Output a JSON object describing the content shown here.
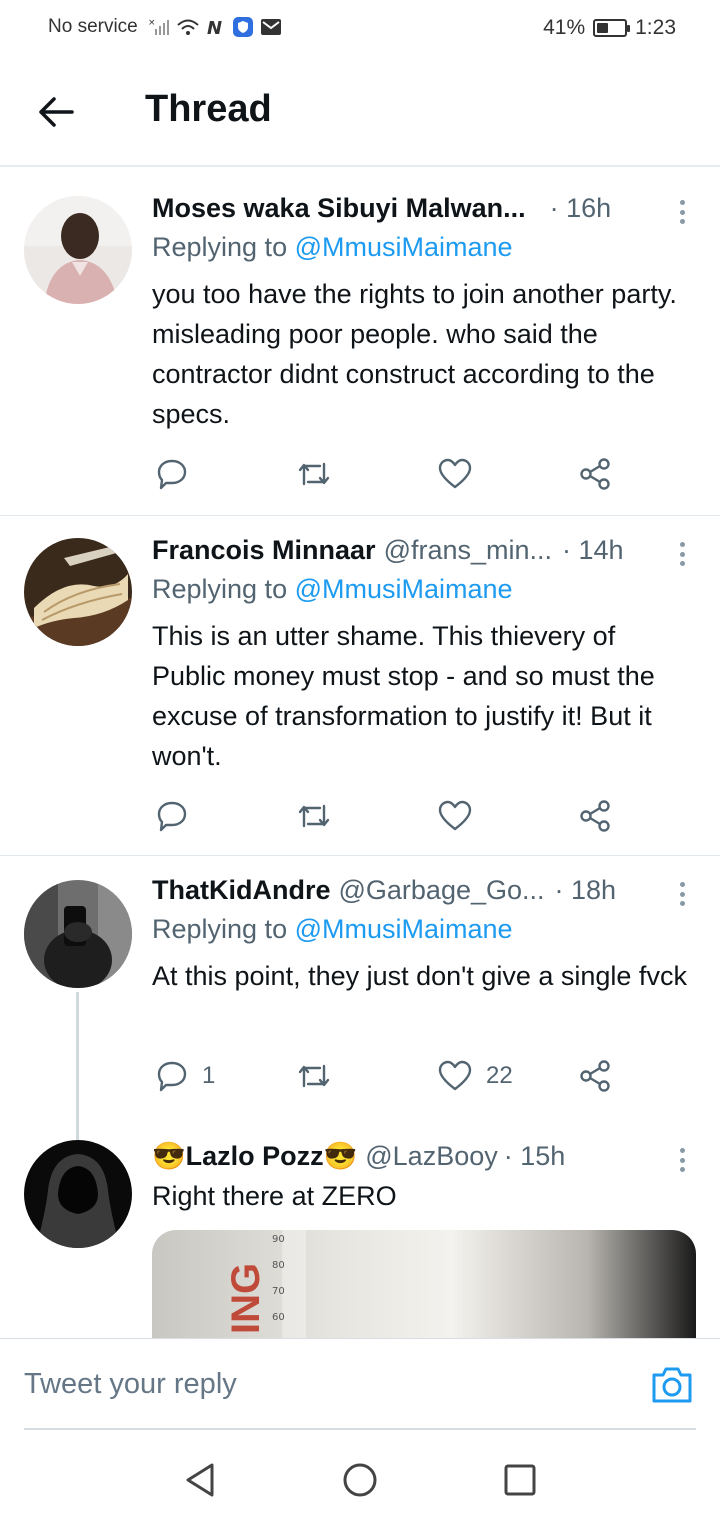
{
  "status_bar": {
    "carrier": "No service",
    "battery_percent": "41%",
    "battery_level": 0.41,
    "time": "1:23"
  },
  "header": {
    "title": "Thread"
  },
  "tweets": [
    {
      "name": "Moses waka Sibuyi Malwan...",
      "handle": "",
      "time": "· 16h",
      "replying_prefix": "Replying to ",
      "replying_to": "@MmusiMaimane",
      "text": "you too have the rights to join another party.  misleading poor people. who said the contractor didnt construct according to the specs.",
      "reply_count": "",
      "like_count": ""
    },
    {
      "name": "Francois Minnaar",
      "handle": "@frans_min...",
      "time": "· 14h",
      "replying_prefix": "Replying to ",
      "replying_to": "@MmusiMaimane",
      "text": "This is an utter shame. This thievery of Public money must stop - and so must the excuse of transformation to justify it! But it won't.",
      "reply_count": "",
      "like_count": ""
    },
    {
      "name": "ThatKidAndre",
      "handle": "@Garbage_Go...",
      "time": "· 18h",
      "replying_prefix": "Replying to ",
      "replying_to": "@MmusiMaimane",
      "text": "At this point, they just don't give a single fvck",
      "reply_count": "1",
      "like_count": "22"
    },
    {
      "name": "😎Lazlo Pozz😎",
      "handle": "@LazBooy",
      "time": "· 15h",
      "text": "Right there at ZERO",
      "media_text": "ING",
      "media_numbers": [
        "90",
        "80",
        "70",
        "60"
      ]
    }
  ],
  "reply_bar": {
    "placeholder": "Tweet your reply"
  },
  "colors": {
    "accent": "#1d9bf0",
    "secondary_text": "#536471",
    "divider": "#e1e8ed"
  }
}
